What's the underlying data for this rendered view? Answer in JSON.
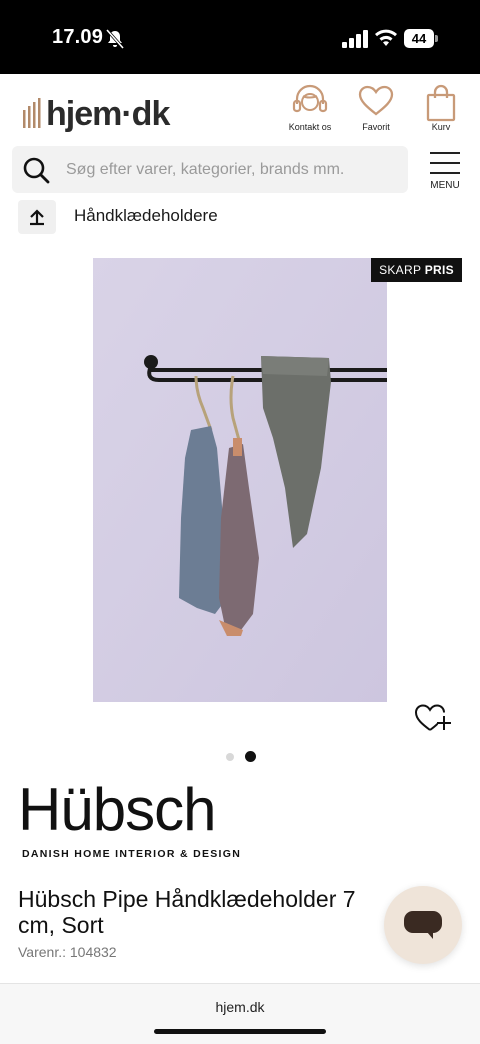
{
  "status_bar": {
    "time": "17.09",
    "battery": "44",
    "icons": [
      "bell-muted-icon",
      "signal-icon",
      "wifi-icon",
      "battery-icon"
    ]
  },
  "header": {
    "logo_text": "hjem·dk",
    "actions": [
      {
        "label": "Kontakt os",
        "icon": "headset-icon"
      },
      {
        "label": "Favorit",
        "icon": "heart-icon"
      },
      {
        "label": "Kurv",
        "icon": "bag-icon"
      }
    ]
  },
  "search": {
    "placeholder": "Søg efter varer, kategorier, brands mm.",
    "value": ""
  },
  "menu": {
    "label": "MENU"
  },
  "breadcrumb": {
    "label": "Håndklædeholdere"
  },
  "badge": {
    "prefix": "SKARP",
    "emphasis": "PRIS"
  },
  "carousel": {
    "total": 2,
    "active": 2
  },
  "brand": {
    "name": "Hübsch",
    "tagline": "DANISH HOME INTERIOR & DESIGN"
  },
  "product": {
    "title": "Hübsch Pipe Håndklædeholder 7... cm, Sort",
    "title_line1": "Hübsch Pipe Håndklædeholder 7",
    "title_line2": "cm, Sort",
    "sku": "Varenr.: 104832"
  },
  "browser": {
    "url": "hjem.dk"
  },
  "colors": {
    "image_background": "#d6d0e4",
    "badge_background": "#111111",
    "chat_background": "#efe4d9"
  }
}
